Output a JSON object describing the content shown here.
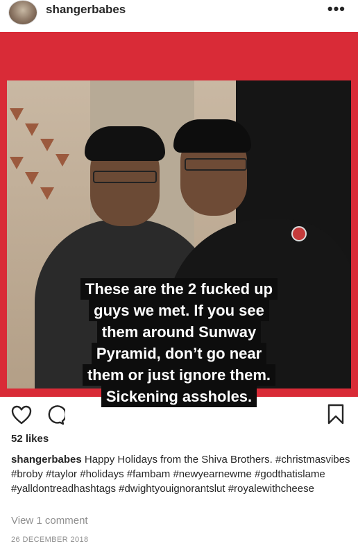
{
  "header": {
    "username": "shangerbabes",
    "more_label": "•••"
  },
  "post": {
    "background_color": "#d92b37",
    "overlay_lines": [
      "These are the 2 fucked up",
      "guys we met. If you see",
      "them around Sunway",
      "Pyramid, don’t go near",
      "them or just ignore them.",
      "Sickening assholes."
    ]
  },
  "actions": {
    "like_icon": "heart-icon",
    "comment_icon": "comment-icon",
    "save_icon": "bookmark-icon"
  },
  "likes": "52 likes",
  "caption": {
    "username": "shangerbabes",
    "text": "Happy Holidays from the Shiva Brothers.",
    "hashtags": "#christmasvibes #broby #taylor #holidays #fambam #newyearnewme #godthatislame #yalldontreadhashtags #dwightyouignorantslut #royalewithcheese"
  },
  "view_comments": "View 1 comment",
  "date": "26 DECEMBER 2018"
}
